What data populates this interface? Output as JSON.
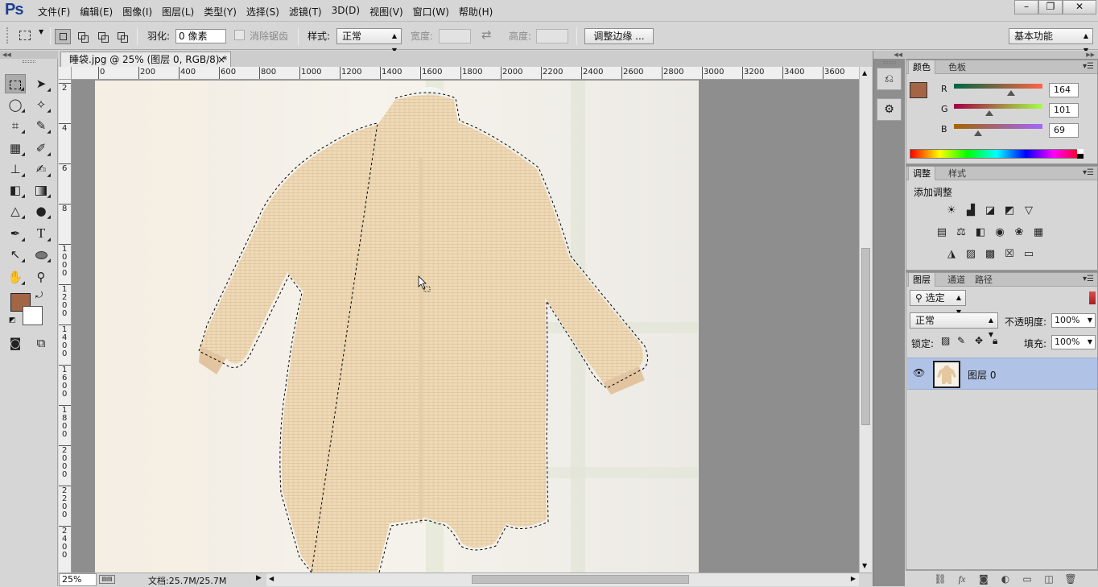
{
  "app": {
    "logo": "Ps",
    "window_controls": [
      "–",
      "❐",
      "✕"
    ]
  },
  "menu": [
    "文件(F)",
    "编辑(E)",
    "图像(I)",
    "图层(L)",
    "类型(Y)",
    "选择(S)",
    "滤镜(T)",
    "3D(D)",
    "视图(V)",
    "窗口(W)",
    "帮助(H)"
  ],
  "options": {
    "feather_label": "羽化:",
    "feather_value": "0 像素",
    "antialias_label": "消除锯齿",
    "style_label": "样式:",
    "style_value": "正常",
    "width_label": "宽度:",
    "height_label": "高度:",
    "refine_edge": "调整边缘 ...",
    "workspace": "基本功能"
  },
  "document": {
    "tab_title": "睡袋.jpg @ 25% (图层 0, RGB/8) *",
    "zoom": "25%",
    "doc_info": "文档:25.7M/25.7M",
    "ruler_h": [
      "0",
      "200",
      "400",
      "600",
      "800",
      "1000",
      "1200",
      "1400",
      "1600",
      "1800",
      "2000",
      "2200",
      "2400",
      "2600",
      "2800",
      "3000",
      "3200",
      "3400",
      "3600"
    ],
    "ruler_v": [
      "2",
      "4",
      "6",
      "8",
      "1\n0\n0\n0",
      "1\n2\n0\n0",
      "1\n4\n0\n0",
      "1\n6\n0\n0",
      "1\n8\n0\n0",
      "2\n0\n0\n0",
      "2\n2\n0\n0",
      "2\n4\n0\n0"
    ]
  },
  "color_panel": {
    "tabs": [
      "颜色",
      "色板"
    ],
    "r_label": "R",
    "g_label": "G",
    "b_label": "B",
    "r": 164,
    "g": 101,
    "b": 69,
    "foreground": "#a46545",
    "background": "#ffffff"
  },
  "adjust_panel": {
    "tabs": [
      "调整",
      "样式"
    ],
    "title": "添加调整"
  },
  "layers_panel": {
    "tabs": [
      "图层",
      "通道",
      "路径"
    ],
    "filter": "选定",
    "blend_mode": "正常",
    "opacity_label": "不透明度:",
    "opacity": "100%",
    "lock_label": "锁定:",
    "fill_label": "填充:",
    "fill": "100%",
    "layer_name": "图层 0"
  }
}
